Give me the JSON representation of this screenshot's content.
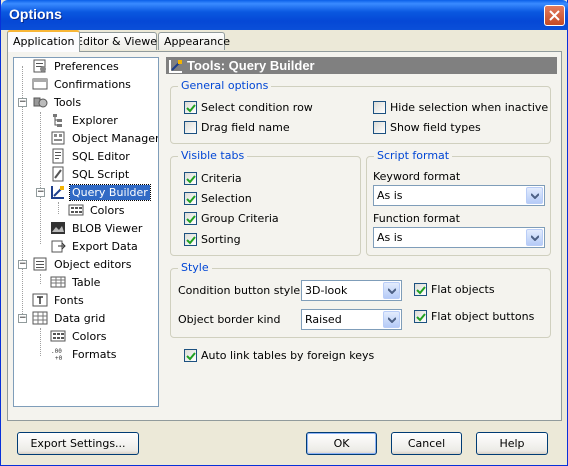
{
  "window": {
    "title": "Options"
  },
  "tabs": [
    {
      "label": "Application",
      "active": true
    },
    {
      "label": "Editor & Viewers",
      "active": false
    },
    {
      "label": "Appearance",
      "active": false
    }
  ],
  "tree": {
    "items": [
      {
        "label": "Preferences",
        "icon": "preferences-icon",
        "level": 1
      },
      {
        "label": "Confirmations",
        "icon": "confirmations-icon",
        "level": 1
      },
      {
        "label": "Tools",
        "icon": "tools-icon",
        "level": 1,
        "expanded": true
      },
      {
        "label": "Explorer",
        "icon": "explorer-icon",
        "level": 2
      },
      {
        "label": "Object Manager",
        "icon": "object-manager-icon",
        "level": 2
      },
      {
        "label": "SQL Editor",
        "icon": "sql-editor-icon",
        "level": 2
      },
      {
        "label": "SQL Script",
        "icon": "sql-script-icon",
        "level": 2
      },
      {
        "label": "Query Builder",
        "icon": "query-builder-icon",
        "level": 2,
        "selected": true,
        "expanded": true
      },
      {
        "label": "Colors",
        "icon": "colors-icon",
        "level": 3
      },
      {
        "label": "BLOB Viewer",
        "icon": "blob-viewer-icon",
        "level": 2
      },
      {
        "label": "Export Data",
        "icon": "export-data-icon",
        "level": 2
      },
      {
        "label": "Object editors",
        "icon": "object-editors-icon",
        "level": 1,
        "expanded": true
      },
      {
        "label": "Table",
        "icon": "table-icon",
        "level": 2
      },
      {
        "label": "Fonts",
        "icon": "fonts-icon",
        "level": 1
      },
      {
        "label": "Data grid",
        "icon": "data-grid-icon",
        "level": 1,
        "expanded": true
      },
      {
        "label": "Colors",
        "icon": "colors-icon",
        "level": 2
      },
      {
        "label": "Formats",
        "icon": "formats-icon",
        "level": 2
      }
    ]
  },
  "content": {
    "title": "Tools: Query Builder",
    "general_options": {
      "legend": "General options",
      "select_condition_row": {
        "label": "Select condition row",
        "checked": true
      },
      "drag_field_name": {
        "label": "Drag field name",
        "checked": false
      },
      "hide_selection_inactive": {
        "label": "Hide selection when inactive",
        "checked": false
      },
      "show_field_types": {
        "label": "Show field types",
        "checked": false
      }
    },
    "visible_tabs": {
      "legend": "Visible tabs",
      "criteria": {
        "label": "Criteria",
        "checked": true
      },
      "selection": {
        "label": "Selection",
        "checked": true
      },
      "group_criteria": {
        "label": "Group Criteria",
        "checked": true
      },
      "sorting": {
        "label": "Sorting",
        "checked": true
      }
    },
    "script_format": {
      "legend": "Script format",
      "keyword_format_label": "Keyword format",
      "keyword_format_value": "As is",
      "function_format_label": "Function format",
      "function_format_value": "As is"
    },
    "style": {
      "legend": "Style",
      "condition_button_style_label": "Condition button style",
      "condition_button_style_value": "3D-look",
      "object_border_kind_label": "Object border kind",
      "object_border_kind_value": "Raised",
      "flat_objects": {
        "label": "Flat objects",
        "checked": true
      },
      "flat_object_buttons": {
        "label": "Flat object buttons",
        "checked": true
      }
    },
    "auto_link": {
      "label": "Auto link tables by foreign keys",
      "checked": true
    }
  },
  "buttons": {
    "export_settings": "Export Settings...",
    "ok": "OK",
    "cancel": "Cancel",
    "help": "Help"
  },
  "colors": {
    "titlebar": "#0a58e0",
    "selection": "#316ac5",
    "legend_text": "#0046d5",
    "check_green": "#21a121"
  }
}
